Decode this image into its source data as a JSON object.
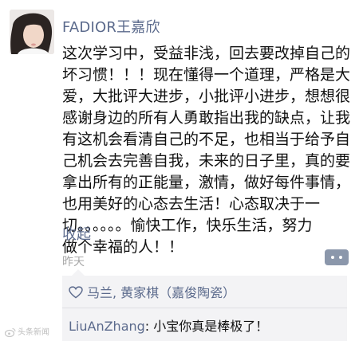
{
  "post": {
    "author": "FADIOR王嘉欣",
    "text_lines": [
      "这次学习中，受益非浅，回去要改掉自己的",
      "坏习惯！！！现在懂得一个道理，严格是大",
      "爱，大批评大进步，小批评小进步，想想很",
      "感谢身边的所有人勇敢指出我的缺点，让我",
      "有这机会看清自己的不足，也相当于给予自",
      "己机会去完善自我，未来的日子里，真的要",
      "拿出所有的正能量，激情，做好每件事情，",
      "也用美好的心态去生活！心态取决于一",
      "切。。。。。。愉快工作，快乐生活，努力",
      "做个幸福的人！！"
    ],
    "collapse_label": "收起",
    "time": "昨天"
  },
  "interactions": {
    "likes": "马兰, 黄家棋（嘉俊陶瓷）",
    "comment": {
      "author": "LiuAnZhang",
      "separator": ": ",
      "text": "小宝你真是棒极了！"
    }
  },
  "icons": {
    "avatar": "avatar-photo",
    "like": "heart-outline-icon",
    "more": "more-dots-icon",
    "watermark": "weibo-logo-icon"
  },
  "watermark_text": "头条新闻",
  "colors": {
    "link": "#5b6a8c",
    "panel_bg": "#f3f3f5",
    "more_button": "#8b97ab"
  }
}
